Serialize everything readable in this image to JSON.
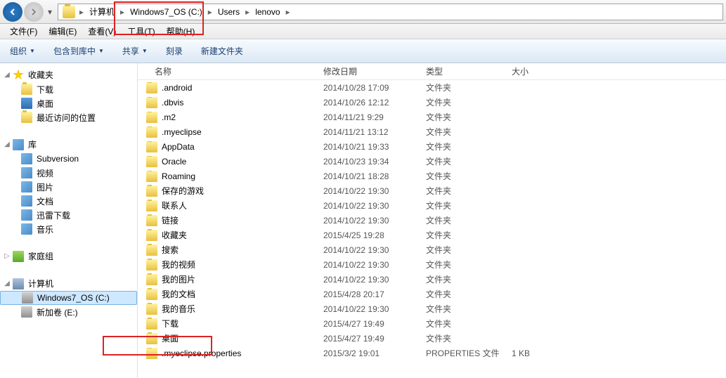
{
  "breadcrumb": [
    "计算机",
    "Windows7_OS (C:)",
    "Users",
    "lenovo"
  ],
  "menubar": [
    {
      "label": "文件(F)"
    },
    {
      "label": "编辑(E)"
    },
    {
      "label": "查看(V)"
    },
    {
      "label": "工具(T)"
    },
    {
      "label": "帮助(H)"
    }
  ],
  "toolbar": [
    {
      "label": "组织",
      "dd": true
    },
    {
      "label": "包含到库中",
      "dd": true
    },
    {
      "label": "共享",
      "dd": true
    },
    {
      "label": "刻录",
      "dd": false
    },
    {
      "label": "新建文件夹",
      "dd": false
    }
  ],
  "sidebar": {
    "favorites": {
      "label": "收藏夹",
      "items": [
        {
          "label": "下载",
          "ico": "folder"
        },
        {
          "label": "桌面",
          "ico": "desktop"
        },
        {
          "label": "最近访问的位置",
          "ico": "folder"
        }
      ]
    },
    "libraries": {
      "label": "库",
      "items": [
        {
          "label": "Subversion",
          "ico": "lib"
        },
        {
          "label": "视频",
          "ico": "lib"
        },
        {
          "label": "图片",
          "ico": "lib"
        },
        {
          "label": "文档",
          "ico": "lib"
        },
        {
          "label": "迅雷下载",
          "ico": "lib"
        },
        {
          "label": "音乐",
          "ico": "lib"
        }
      ]
    },
    "homegroup": {
      "label": "家庭组"
    },
    "computer": {
      "label": "计算机",
      "items": [
        {
          "label": "Windows7_OS (C:)",
          "ico": "drive",
          "sel": true
        },
        {
          "label": "新加卷 (E:)",
          "ico": "drive"
        }
      ]
    }
  },
  "columns": {
    "name": "名称",
    "date": "修改日期",
    "type": "类型",
    "size": "大小"
  },
  "files": [
    {
      "name": ".android",
      "date": "2014/10/28 17:09",
      "type": "文件夹",
      "size": ""
    },
    {
      "name": ".dbvis",
      "date": "2014/10/26 12:12",
      "type": "文件夹",
      "size": ""
    },
    {
      "name": ".m2",
      "date": "2014/11/21 9:29",
      "type": "文件夹",
      "size": ""
    },
    {
      "name": ".myeclipse",
      "date": "2014/11/21 13:12",
      "type": "文件夹",
      "size": ""
    },
    {
      "name": "AppData",
      "date": "2014/10/21 19:33",
      "type": "文件夹",
      "size": ""
    },
    {
      "name": "Oracle",
      "date": "2014/10/23 19:34",
      "type": "文件夹",
      "size": ""
    },
    {
      "name": "Roaming",
      "date": "2014/10/21 18:28",
      "type": "文件夹",
      "size": ""
    },
    {
      "name": "保存的游戏",
      "date": "2014/10/22 19:30",
      "type": "文件夹",
      "size": ""
    },
    {
      "name": "联系人",
      "date": "2014/10/22 19:30",
      "type": "文件夹",
      "size": ""
    },
    {
      "name": "链接",
      "date": "2014/10/22 19:30",
      "type": "文件夹",
      "size": ""
    },
    {
      "name": "收藏夹",
      "date": "2015/4/25 19:28",
      "type": "文件夹",
      "size": ""
    },
    {
      "name": "搜索",
      "date": "2014/10/22 19:30",
      "type": "文件夹",
      "size": ""
    },
    {
      "name": "我的视频",
      "date": "2014/10/22 19:30",
      "type": "文件夹",
      "size": ""
    },
    {
      "name": "我的图片",
      "date": "2014/10/22 19:30",
      "type": "文件夹",
      "size": ""
    },
    {
      "name": "我的文档",
      "date": "2015/4/28 20:17",
      "type": "文件夹",
      "size": ""
    },
    {
      "name": "我的音乐",
      "date": "2014/10/22 19:30",
      "type": "文件夹",
      "size": ""
    },
    {
      "name": "下载",
      "date": "2015/4/27 19:49",
      "type": "文件夹",
      "size": ""
    },
    {
      "name": "桌面",
      "date": "2015/4/27 19:49",
      "type": "文件夹",
      "size": ""
    },
    {
      "name": ".myeclipse.properties",
      "date": "2015/3/2 19:01",
      "type": "PROPERTIES 文件",
      "size": "1 KB"
    }
  ]
}
